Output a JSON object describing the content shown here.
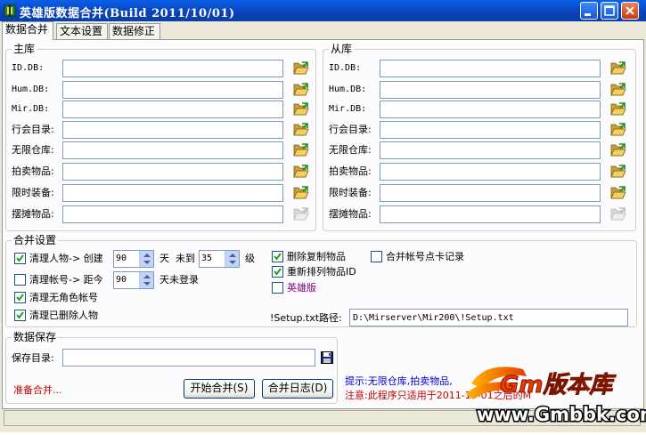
{
  "window": {
    "title": "英雄版数据合并(Build 2011/10/01)"
  },
  "tabs": [
    {
      "label": "数据合并"
    },
    {
      "label": "文本设置"
    },
    {
      "label": "数据修正"
    }
  ],
  "master": {
    "title": "主库",
    "rows": [
      {
        "label": "ID.DB:",
        "value": ""
      },
      {
        "label": "Hum.DB:",
        "value": ""
      },
      {
        "label": "Mir.DB:",
        "value": ""
      },
      {
        "label": "行会目录:",
        "value": ""
      },
      {
        "label": "无限仓库:",
        "value": ""
      },
      {
        "label": "拍卖物品:",
        "value": ""
      },
      {
        "label": "限时装备:",
        "value": ""
      },
      {
        "label": "摆摊物品:",
        "value": ""
      }
    ]
  },
  "slave": {
    "title": "从库",
    "rows": [
      {
        "label": "ID.DB:",
        "value": ""
      },
      {
        "label": "Hum.DB:",
        "value": ""
      },
      {
        "label": "Mir.DB:",
        "value": ""
      },
      {
        "label": "行会目录:",
        "value": ""
      },
      {
        "label": "无限仓库:",
        "value": ""
      },
      {
        "label": "拍卖物品:",
        "value": ""
      },
      {
        "label": "限时装备:",
        "value": ""
      },
      {
        "label": "摆摊物品:",
        "value": ""
      }
    ]
  },
  "merge": {
    "title": "合并设置",
    "clean_char": {
      "label": "清理人物-> 创建",
      "checked": true,
      "create_days": "90",
      "tian": "天",
      "until_label": "未到",
      "level": "35",
      "level_unit": "级"
    },
    "clean_acct": {
      "label": "清理帐号-> 距今",
      "checked": false,
      "days": "90",
      "suffix": "天未登录"
    },
    "clean_nochar": {
      "label": "清理无角色帐号",
      "checked": true
    },
    "clean_deleted": {
      "label": "清理已删除人物",
      "checked": true
    },
    "del_copy": {
      "label": "删除复制物品",
      "checked": true
    },
    "renum": {
      "label": "重新排列物品ID",
      "checked": true
    },
    "hero": {
      "label": "英雄版",
      "checked": false,
      "color": "#800080"
    },
    "acct_card": {
      "label": "合并帐号点卡记录",
      "checked": false
    },
    "setup_path": {
      "label": "!Setup.txt路径:",
      "value": "D:\\Mirserver\\Mir200\\!Setup.txt"
    }
  },
  "save": {
    "title": "数据保存",
    "dir_label": "保存目录:",
    "dir_value": "",
    "status": "准备合并...",
    "status_color": "#CC0000",
    "start_button": "开始合并(S)",
    "log_button": "合并日志(D)"
  },
  "hint": {
    "line1": "提示:无限仓库,拍卖物品,",
    "line1_color": "#0000CC",
    "line2": "注意:此程序只适用于2011-10-01之后的M",
    "line2_color": "#CC0000"
  },
  "watermark": {
    "brand": "Gm版本库",
    "url": "www.Gmbbk.com"
  }
}
